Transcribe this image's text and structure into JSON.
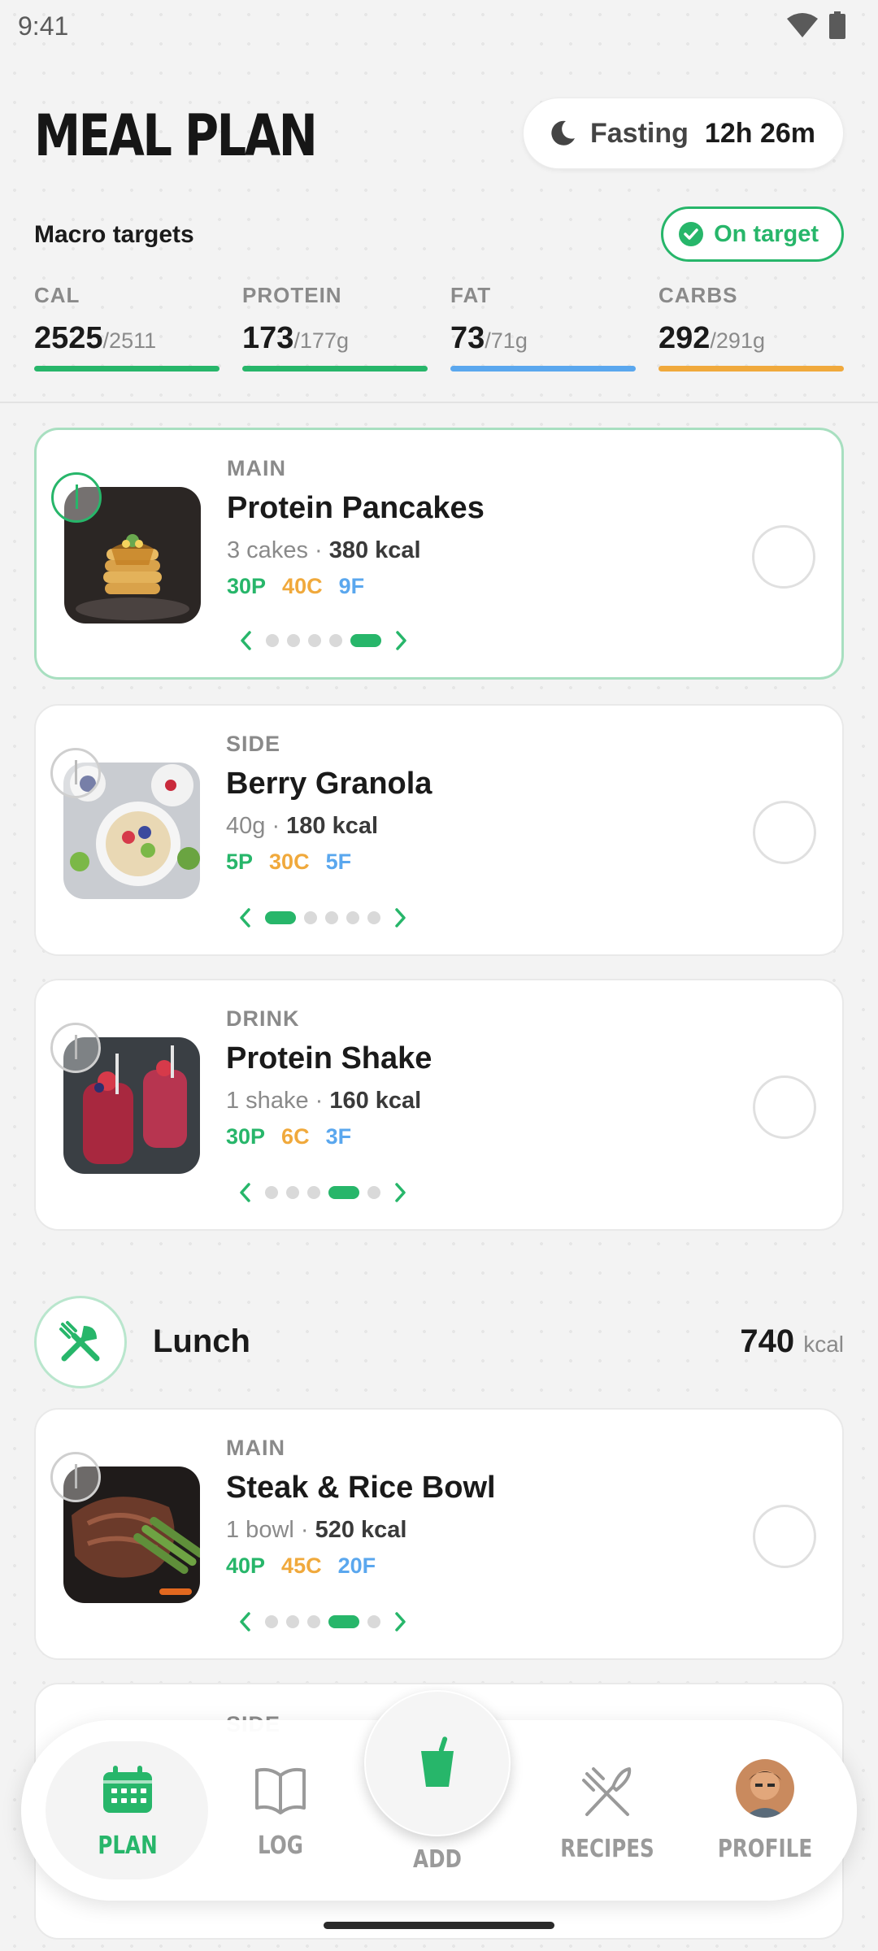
{
  "status_bar": {
    "time": "9:41"
  },
  "header": {
    "title": "MEAL PLAN",
    "fasting_label": "Fasting",
    "fasting_time": "12h 26m"
  },
  "macros": {
    "title": "Macro targets",
    "status_label": "On target",
    "items": [
      {
        "label": "CAL",
        "value": "2525",
        "target": "/2511",
        "color": "#27b66a"
      },
      {
        "label": "PROTEIN",
        "value": "173",
        "target": "/177g",
        "color": "#27b66a"
      },
      {
        "label": "FAT",
        "value": "73",
        "target": "/71g",
        "color": "#5aa7ee"
      },
      {
        "label": "CARBS",
        "value": "292",
        "target": "/291g",
        "color": "#f0a93c"
      }
    ]
  },
  "breakfast_items": [
    {
      "category": "MAIN",
      "name": "Protein Pancakes",
      "portion": "3 cakes",
      "kcal": "380 kcal",
      "protein": "30P",
      "carbs": "40C",
      "fat": "9F",
      "page": 5,
      "pages": 5,
      "selected": true
    },
    {
      "category": "SIDE",
      "name": "Berry Granola",
      "portion": "40g",
      "kcal": "180 kcal",
      "protein": "5P",
      "carbs": "30C",
      "fat": "5F",
      "page": 1,
      "pages": 5,
      "selected": false
    },
    {
      "category": "DRINK",
      "name": "Protein Shake",
      "portion": "1 shake",
      "kcal": "160 kcal",
      "protein": "30P",
      "carbs": "6C",
      "fat": "3F",
      "page": 4,
      "pages": 5,
      "selected": false
    }
  ],
  "lunch": {
    "title": "Lunch",
    "kcal": "740",
    "kcal_unit": "kcal",
    "items": [
      {
        "category": "MAIN",
        "name": "Steak & Rice Bowl",
        "portion": "1 bowl",
        "kcal": "520 kcal",
        "protein": "40P",
        "carbs": "45C",
        "fat": "20F",
        "page": 4,
        "pages": 5,
        "selected": false
      },
      {
        "category": "SIDE"
      }
    ]
  },
  "bottom_nav": {
    "plan": "PLAN",
    "log": "LOG",
    "add": "ADD",
    "recipes": "RECIPES",
    "profile": "PROFILE"
  },
  "colors": {
    "accent": "#27b66a",
    "carbs": "#f0a93c",
    "fat": "#5aa7ee"
  }
}
